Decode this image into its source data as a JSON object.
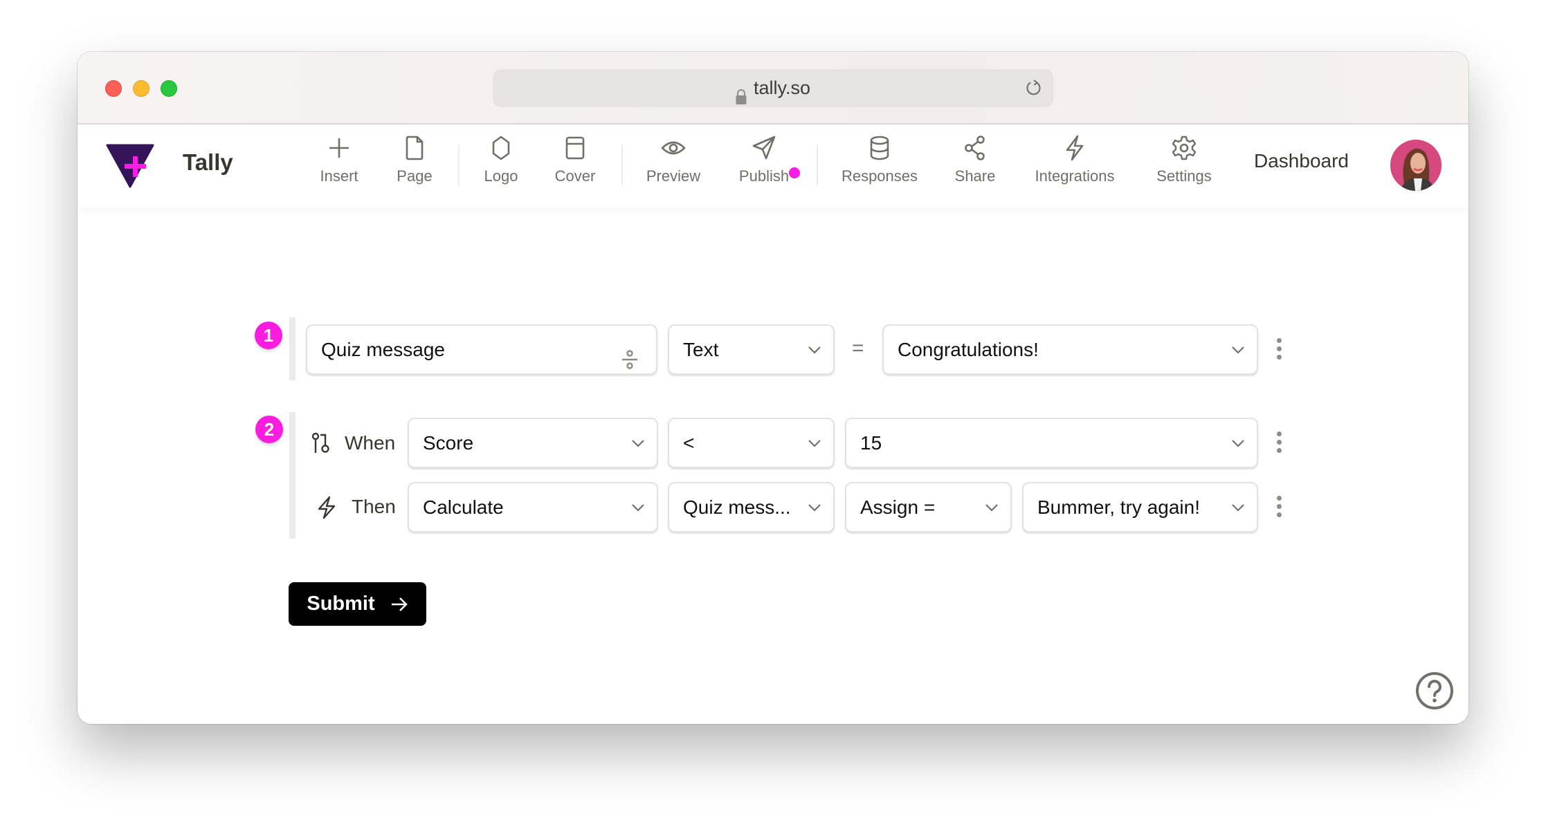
{
  "browser": {
    "url": "tally.so",
    "lock_icon": "lock-icon",
    "reload_icon": "reload-icon"
  },
  "header": {
    "brand": "Tally",
    "toolbar": [
      {
        "label": "Insert",
        "icon": "plus-icon"
      },
      {
        "label": "Page",
        "icon": "page-icon"
      },
      {
        "label": "Logo",
        "icon": "hexagon-icon"
      },
      {
        "label": "Cover",
        "icon": "cover-icon"
      },
      {
        "label": "Preview",
        "icon": "eye-icon"
      },
      {
        "label": "Publish",
        "icon": "send-icon",
        "notification_dot": true
      },
      {
        "label": "Responses",
        "icon": "database-icon"
      },
      {
        "label": "Share",
        "icon": "share-icon"
      },
      {
        "label": "Integrations",
        "icon": "lightning-icon"
      },
      {
        "label": "Settings",
        "icon": "gear-icon"
      }
    ],
    "dashboard": "Dashboard",
    "accent_color": "#f81ce5"
  },
  "blocks": [
    {
      "number": "1",
      "variable": "Quiz message",
      "type": "Text",
      "operator": "=",
      "value": "Congratulations!"
    },
    {
      "number": "2",
      "when": {
        "label": "When",
        "field": "Score",
        "comparator": "<",
        "value": "15"
      },
      "then": {
        "label": "Then",
        "action": "Calculate",
        "target": "Quiz mess...",
        "operation": "Assign =",
        "value": "Bummer, try again!"
      }
    }
  ],
  "submit": {
    "label": "Submit"
  },
  "help_icon": "help-icon"
}
